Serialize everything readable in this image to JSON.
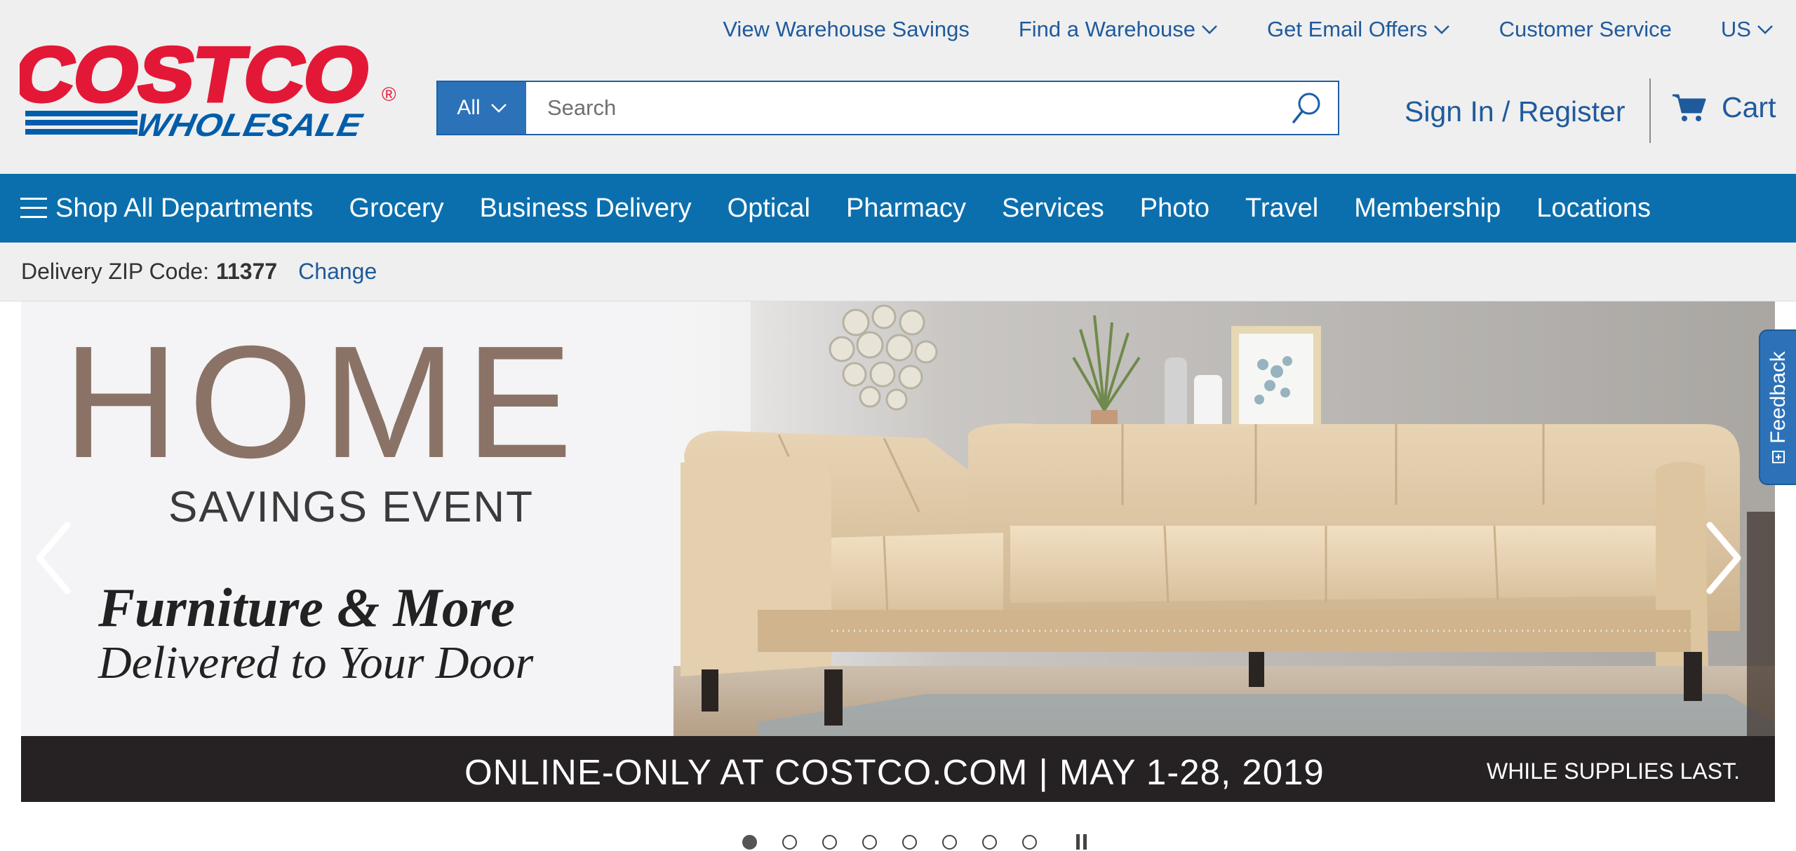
{
  "utility_nav": [
    {
      "label": "View Warehouse Savings",
      "dropdown": false
    },
    {
      "label": "Find a Warehouse",
      "dropdown": true
    },
    {
      "label": "Get Email Offers",
      "dropdown": true
    },
    {
      "label": "Customer Service",
      "dropdown": false
    },
    {
      "label": "US",
      "dropdown": true
    }
  ],
  "logo": {
    "top": "COSTCO",
    "bottom": "WHOLESALE",
    "mark": "®"
  },
  "search": {
    "category": "All",
    "placeholder": "Search"
  },
  "account": {
    "sign_in": "Sign In / Register",
    "cart": "Cart"
  },
  "main_nav": [
    "Shop All Departments",
    "Grocery",
    "Business Delivery",
    "Optical",
    "Pharmacy",
    "Services",
    "Photo",
    "Travel",
    "Membership",
    "Locations"
  ],
  "delivery": {
    "label": "Delivery ZIP Code:",
    "zip": "11377",
    "change": "Change"
  },
  "hero": {
    "headline": "HOME",
    "subheadline": "SAVINGS EVENT",
    "line1": "Furniture & More",
    "line2": "Delivered to Your Door",
    "strip_main": "ONLINE-ONLY AT COSTCO.COM | MAY 1-28, 2019",
    "strip_right": "WHILE SUPPLIES LAST."
  },
  "carousel": {
    "slide_count": 8,
    "active_index": 0
  },
  "feedback": {
    "label": "Feedback"
  },
  "colors": {
    "brand_red": "#e31837",
    "brand_blue": "#005daa",
    "nav_blue": "#0c6fad",
    "link_blue": "#1f5a9c",
    "header_bg": "#efefef"
  },
  "icons": [
    "chevron-down-icon",
    "search-icon",
    "cart-icon",
    "menu-icon",
    "arrow-left-icon",
    "arrow-right-icon",
    "pause-icon",
    "feedback-icon"
  ]
}
